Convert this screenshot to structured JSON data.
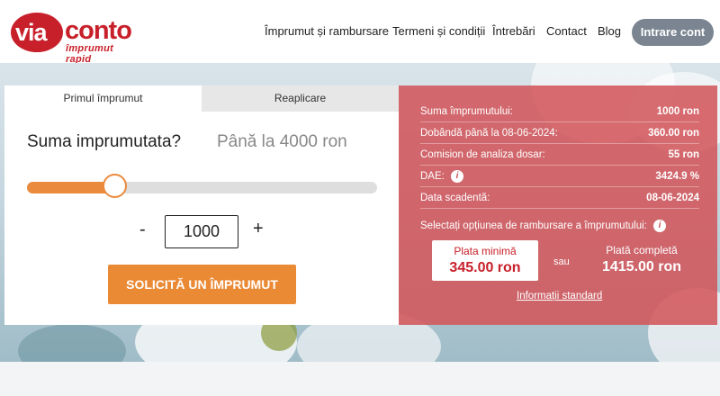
{
  "brand": {
    "logo_via": "via",
    "logo_conto": "conto",
    "tagline": "împrumut rapid"
  },
  "nav": {
    "items": [
      {
        "label": "Împrumut și rambursare"
      },
      {
        "label": "Termeni și condiții"
      },
      {
        "label": "Întrebări"
      },
      {
        "label": "Contact"
      },
      {
        "label": "Blog"
      }
    ],
    "login_label": "Intrare cont"
  },
  "calculator": {
    "tabs": [
      {
        "label": "Primul împrumut",
        "active": true
      },
      {
        "label": "Reaplicare",
        "active": false
      }
    ],
    "question": "Suma imprumutata?",
    "max_text": "Până la 4000 ron",
    "slider": {
      "min": 0,
      "max": 4000,
      "value": 1000
    },
    "minus_label": "-",
    "plus_label": "+",
    "amount_value": "1000",
    "cta_label": "SOLICITĂ UN ÎMPRUMUT"
  },
  "summary": {
    "rows": [
      {
        "label": "Suma împrumutului:",
        "value": "1000 ron"
      },
      {
        "label": "Dobândă până la 08-06-2024:",
        "value": "360.00 ron"
      },
      {
        "label": "Comision de analiza dosar:",
        "value": "55 ron"
      },
      {
        "label": "DAE:",
        "value": "3424.9 %",
        "info_icon": true
      },
      {
        "label": "Data scadentă:",
        "value": "08-06-2024"
      }
    ],
    "select_text": "Selectați opțiunea de rambursare a împrumutului:",
    "option_min": {
      "label": "Plata minimă",
      "amount": "345.00 ron"
    },
    "or_text": "sau",
    "option_full": {
      "label": "Plată completă",
      "amount": "1415.00 ron"
    },
    "info_link": "Informații standard"
  },
  "colors": {
    "brand_red": "#c8202a",
    "accent_orange": "#ea8a35",
    "panel_red": "#d25458",
    "login_gray": "#7a8591"
  }
}
